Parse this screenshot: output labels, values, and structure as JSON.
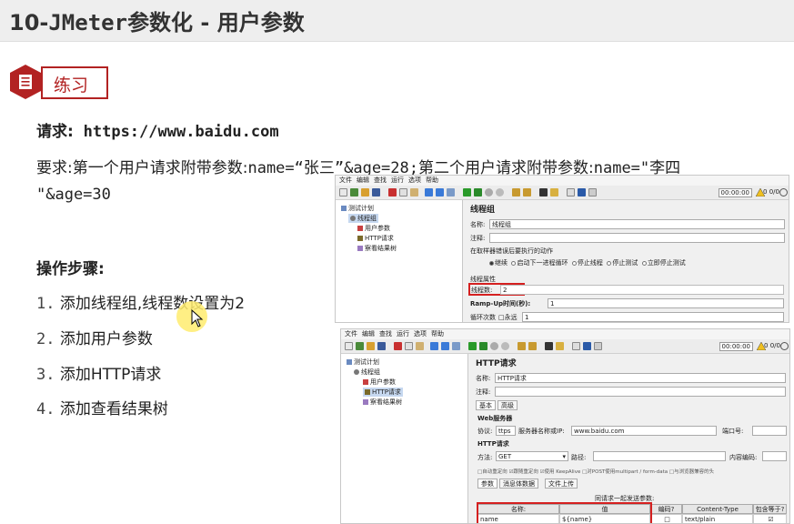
{
  "header": {
    "title_prefix": "10-",
    "title_mono": "JMeter",
    "title_suffix": "参数化 - 用户参数"
  },
  "section": {
    "badge": "练习"
  },
  "request": {
    "label": "请求:",
    "url": "https://www.baidu.com"
  },
  "requirement": {
    "part1": "要求:第一个用户请求附带参数:",
    "part2": "name=“张三”&age=28;",
    "part3": "第二个用户请求附带参数:",
    "part4": "name=\"李四",
    "part5": "\"&age=30"
  },
  "steps": {
    "label": "操作步骤:",
    "items": [
      {
        "num": "1.",
        "text": "添加线程组,线程数设置为2"
      },
      {
        "num": "2.",
        "text": "添加用户参数"
      },
      {
        "num": "3.",
        "text": "添加HTTP请求"
      },
      {
        "num": "4.",
        "text": "添加查看结果树"
      }
    ]
  },
  "jmeter_common": {
    "menu": [
      "文件",
      "编辑",
      "查找",
      "运行",
      "选项",
      "帮助"
    ],
    "timer": "00:00:00",
    "counter": "0 0/0"
  },
  "shot1": {
    "tree": [
      "测试计划",
      "线程组",
      "用户参数",
      "HTTP请求",
      "察看结果树"
    ],
    "panel_title": "线程组",
    "name_label": "名称:",
    "name_value": "线程组",
    "comment_label": "注释:",
    "on_error_label": "在取样器错误后要执行的动作",
    "actions": [
      "继续",
      "启动下一进程循环",
      "停止线程",
      "停止测试",
      "立即停止测试"
    ],
    "props_label": "线程属性",
    "threads_label": "线程数:",
    "threads_value": "2",
    "rampup_label": "Ramp-Up时间(秒):",
    "rampup_value": "1",
    "loop_label": "循环次数",
    "loop_forever": "永远",
    "loop_value": "1"
  },
  "shot2": {
    "tree": [
      "测试计划",
      "线程组",
      "用户参数",
      "HTTP请求",
      "察看结果树"
    ],
    "panel_title": "HTTP请求",
    "name_label": "名称:",
    "name_value": "HTTP请求",
    "comment_label": "注释:",
    "tabs": [
      "基本",
      "高级"
    ],
    "web_server": "Web服务器",
    "protocol_label": "协议:",
    "protocol_value": "ttps",
    "server_label": "服务器名称或IP:",
    "server_value": "www.baidu.com",
    "port_label": "端口号:",
    "http_req_label": "HTTP请求",
    "method_label": "方法:",
    "method_value": "GET",
    "path_label": "路径:",
    "encoding_label": "内容编码:",
    "options": "□自动重定向 ☑跟随重定向 ☑使用 KeepAlive □对POST使用multipart / form-data □与浏览器兼容的头",
    "param_tabs": [
      "参数",
      "消息体数据",
      "文件上传"
    ],
    "send_with": "同请求一起发送参数:",
    "col_name": "名称:",
    "col_value": "值",
    "col_encode": "编码?",
    "col_ctype": "Content-Type",
    "col_include": "包含等于?",
    "row_name": "name",
    "row_value": "${name}",
    "row_ctype": "text/plain"
  }
}
